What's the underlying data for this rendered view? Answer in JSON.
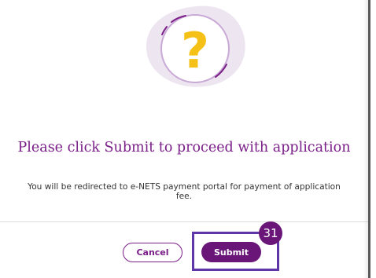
{
  "dialog": {
    "title": "Please click Submit to proceed with application",
    "message": "You will be redirected to e-NETS payment portal for payment of application fee.",
    "illustration_icon": "question-mark-icon"
  },
  "buttons": {
    "cancel_label": "Cancel",
    "submit_label": "Submit"
  },
  "annotation": {
    "step_number": "31"
  },
  "colors": {
    "brand_purple": "#7a1e88",
    "submit_bg": "#6a1678",
    "highlight_border": "#5f37a8",
    "icon_yellow": "#f5c116",
    "blob_lavender": "#ede6f1"
  }
}
